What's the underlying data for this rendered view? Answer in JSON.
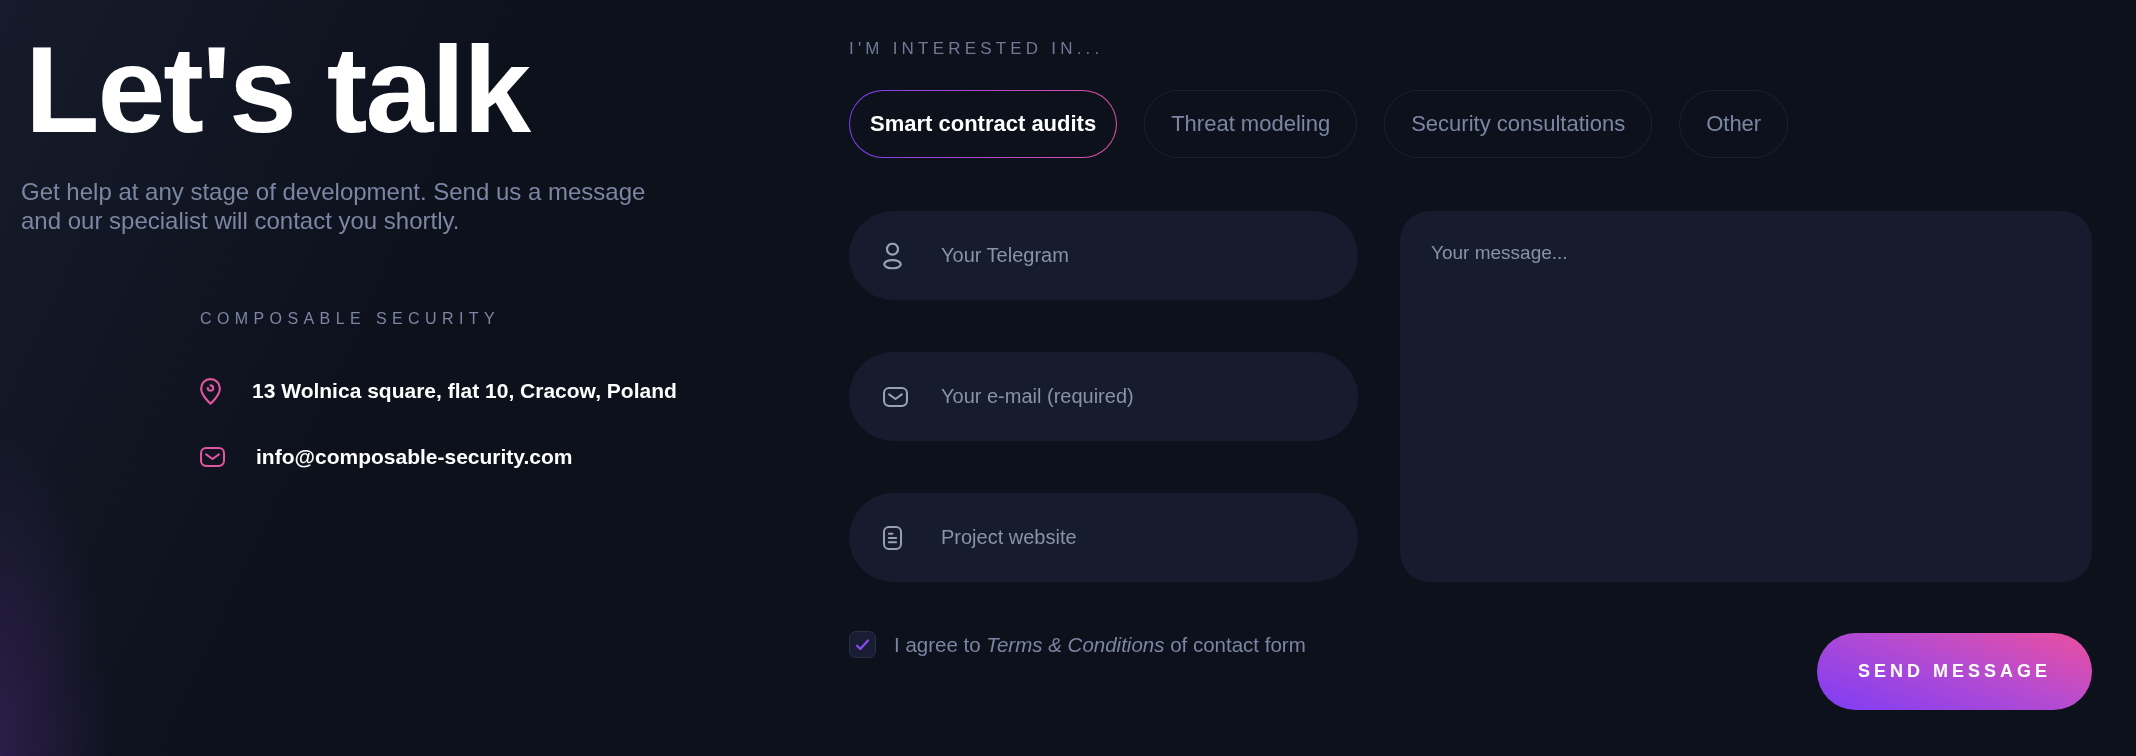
{
  "intro": {
    "title": "Let's talk",
    "subtitle": "Get help at any stage of development. Send us a message and our specialist will contact you shortly."
  },
  "contact": {
    "company": "COMPOSABLE SECURITY",
    "items": [
      {
        "kind": "address",
        "text": "13 Wolnica square, flat 10, Cracow, Poland"
      },
      {
        "kind": "email",
        "text": "info@composable-security.com"
      }
    ]
  },
  "form": {
    "interests_label": "I'M INTERESTED IN...",
    "interests": [
      {
        "label": "Smart contract audits",
        "selected": true
      },
      {
        "label": "Threat modeling",
        "selected": false
      },
      {
        "label": "Security consultations",
        "selected": false
      },
      {
        "label": "Other",
        "selected": false
      }
    ],
    "fields": [
      {
        "kind": "telegram",
        "placeholder": "Your Telegram"
      },
      {
        "kind": "email",
        "placeholder": "Your e-mail (required)"
      },
      {
        "kind": "website",
        "placeholder": "Project website"
      }
    ],
    "message": {
      "placeholder": "Your message..."
    },
    "consent": {
      "text": "I agree to *Terms & Conditions* of contact form",
      "checked": true
    },
    "submit": "SEND MESSAGE"
  }
}
